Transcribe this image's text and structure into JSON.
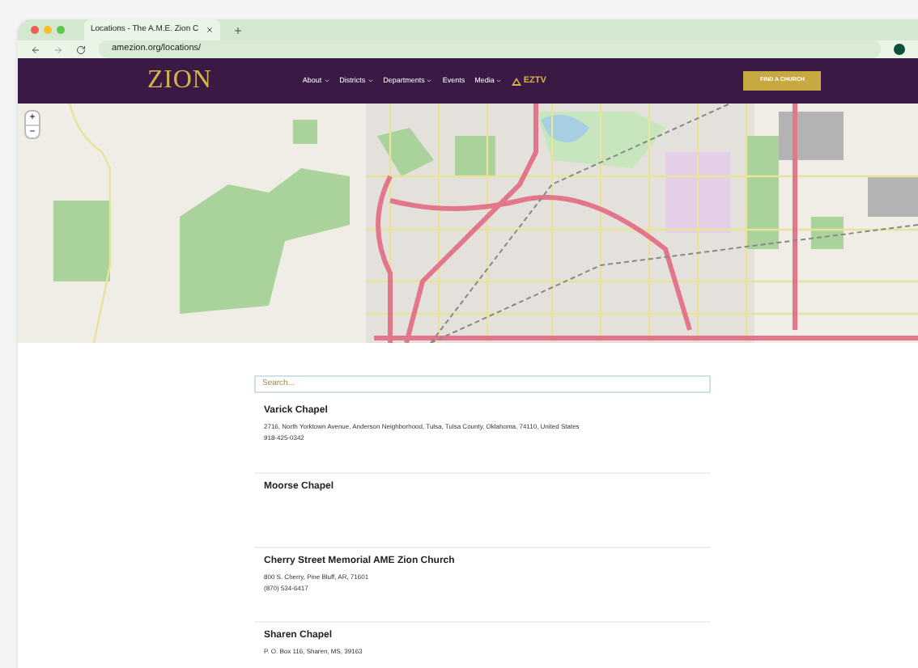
{
  "browser": {
    "tab_title": "Locations - The A.M.E. Zion C",
    "url": "amezion.org/locations/"
  },
  "site": {
    "logo": "ZION",
    "nav": [
      {
        "label": "About",
        "dropdown": true
      },
      {
        "label": "Districts",
        "dropdown": true
      },
      {
        "label": "Departments",
        "dropdown": true
      },
      {
        "label": "Events",
        "dropdown": false
      },
      {
        "label": "Media",
        "dropdown": true
      }
    ],
    "tv_logo": "EZTV",
    "cta": "FIND A CHURCH"
  },
  "map": {
    "zoom_in": "+",
    "zoom_out": "−"
  },
  "search": {
    "placeholder": "Search..."
  },
  "locations": [
    {
      "name": "Varick Chapel",
      "address": "2716, North Yorktown Avenue, Anderson Neighborhood, Tulsa, Tulsa County, Oklahoma, 74110, United States",
      "phone": "918-425-0342"
    },
    {
      "name": "Moorse Chapel"
    },
    {
      "name": "Cherry Street Memorial AME Zion Church",
      "address": "800 S. Cherry, Pine Bluff, AR, 71601",
      "phone": "(870) 534-6417"
    },
    {
      "name": "Sharen Chapel",
      "address": "P. O. Box 116, Sharen, MS, 39163"
    }
  ]
}
